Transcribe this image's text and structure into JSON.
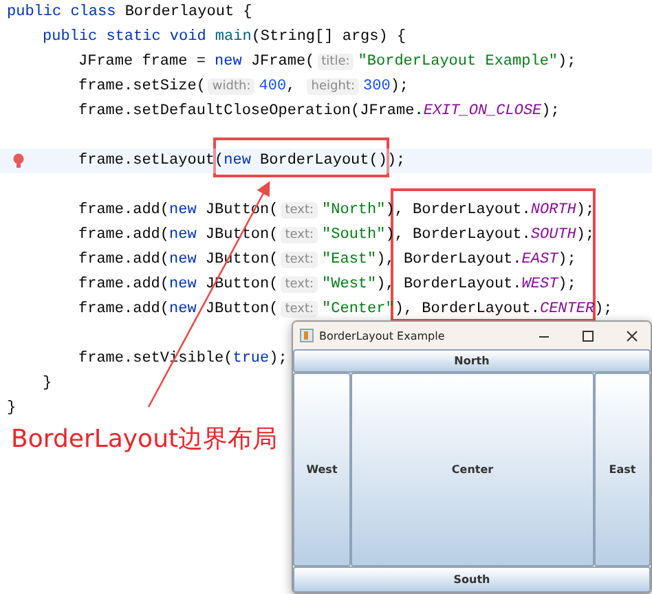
{
  "code_lines": [
    {
      "kind": "code",
      "current": false,
      "bulb": false,
      "tokens": [
        {
          "kind": "kw",
          "t": "public class "
        },
        {
          "kind": "plain",
          "t": "Borderlayout {"
        }
      ],
      "children": [
        {
          "kind": "code",
          "current": false,
          "bulb": false,
          "tokens": [
            {
              "kind": "kw",
              "t": "public static void "
            },
            {
              "kind": "method",
              "t": "main"
            },
            {
              "kind": "plain",
              "t": "(String[] args) {"
            }
          ],
          "children": [
            {
              "kind": "code",
              "current": false,
              "bulb": false,
              "tokens": [
                {
                  "kind": "plain",
                  "t": "JFrame frame = "
                },
                {
                  "kind": "kw",
                  "t": "new "
                },
                {
                  "kind": "plain",
                  "t": "JFrame("
                },
                {
                  "kind": "hint",
                  "t": "title:"
                },
                {
                  "kind": "str",
                  "t": "\"BorderLayout Example\""
                },
                {
                  "kind": "plain",
                  "t": ");"
                }
              ]
            },
            {
              "kind": "code",
              "current": false,
              "bulb": false,
              "tokens": [
                {
                  "kind": "plain",
                  "t": "frame.setSize("
                },
                {
                  "kind": "hint",
                  "t": "width:"
                },
                {
                  "kind": "num",
                  "t": "400"
                },
                {
                  "kind": "plain",
                  "t": ", "
                },
                {
                  "kind": "hint",
                  "t": "height:"
                },
                {
                  "kind": "num",
                  "t": "300"
                },
                {
                  "kind": "plain",
                  "t": ");"
                }
              ]
            },
            {
              "kind": "code",
              "current": false,
              "bulb": false,
              "tokens": [
                {
                  "kind": "plain",
                  "t": "frame.setDefaultCloseOperation(JFrame."
                },
                {
                  "kind": "const",
                  "t": "EXIT_ON_CLOSE"
                },
                {
                  "kind": "plain",
                  "t": ");"
                }
              ]
            },
            {
              "kind": "blank",
              "current": false,
              "bulb": false
            },
            {
              "kind": "code",
              "current": true,
              "bulb": true,
              "tokens": [
                {
                  "kind": "plain",
                  "t": "frame.setLayout("
                },
                {
                  "kind": "kw",
                  "t": "new "
                },
                {
                  "kind": "plain",
                  "t": "BorderLayout());"
                }
              ]
            },
            {
              "kind": "blank",
              "current": false,
              "bulb": false
            },
            {
              "kind": "code",
              "current": false,
              "bulb": false,
              "tokens": [
                {
                  "kind": "plain",
                  "t": "frame.add("
                },
                {
                  "kind": "kw",
                  "t": "new "
                },
                {
                  "kind": "plain",
                  "t": "JButton("
                },
                {
                  "kind": "hint",
                  "t": "text:"
                },
                {
                  "kind": "str",
                  "t": "\"North\""
                },
                {
                  "kind": "plain",
                  "t": "), BorderLayout."
                },
                {
                  "kind": "const",
                  "t": "NORTH"
                },
                {
                  "kind": "plain",
                  "t": ");"
                }
              ]
            },
            {
              "kind": "code",
              "current": false,
              "bulb": false,
              "tokens": [
                {
                  "kind": "plain",
                  "t": "frame.add("
                },
                {
                  "kind": "kw",
                  "t": "new "
                },
                {
                  "kind": "plain",
                  "t": "JButton("
                },
                {
                  "kind": "hint",
                  "t": "text:"
                },
                {
                  "kind": "str",
                  "t": "\"South\""
                },
                {
                  "kind": "plain",
                  "t": "), BorderLayout."
                },
                {
                  "kind": "const",
                  "t": "SOUTH"
                },
                {
                  "kind": "plain",
                  "t": ");"
                }
              ]
            },
            {
              "kind": "code",
              "current": false,
              "bulb": false,
              "tokens": [
                {
                  "kind": "plain",
                  "t": "frame.add("
                },
                {
                  "kind": "kw",
                  "t": "new "
                },
                {
                  "kind": "plain",
                  "t": "JButton("
                },
                {
                  "kind": "hint",
                  "t": "text:"
                },
                {
                  "kind": "str",
                  "t": "\"East\""
                },
                {
                  "kind": "plain",
                  "t": "), BorderLayout."
                },
                {
                  "kind": "const",
                  "t": "EAST"
                },
                {
                  "kind": "plain",
                  "t": ");"
                }
              ]
            },
            {
              "kind": "code",
              "current": false,
              "bulb": false,
              "tokens": [
                {
                  "kind": "plain",
                  "t": "frame.add("
                },
                {
                  "kind": "kw",
                  "t": "new "
                },
                {
                  "kind": "plain",
                  "t": "JButton("
                },
                {
                  "kind": "hint",
                  "t": "text:"
                },
                {
                  "kind": "str",
                  "t": "\"West\""
                },
                {
                  "kind": "plain",
                  "t": "), BorderLayout."
                },
                {
                  "kind": "const",
                  "t": "WEST"
                },
                {
                  "kind": "plain",
                  "t": ");"
                }
              ]
            },
            {
              "kind": "code",
              "current": false,
              "bulb": false,
              "tokens": [
                {
                  "kind": "plain",
                  "t": "frame.add("
                },
                {
                  "kind": "kw",
                  "t": "new "
                },
                {
                  "kind": "plain",
                  "t": "JButton("
                },
                {
                  "kind": "hint",
                  "t": "text:"
                },
                {
                  "kind": "str",
                  "t": "\"Center\""
                },
                {
                  "kind": "plain",
                  "t": "), BorderLayout."
                },
                {
                  "kind": "const",
                  "t": "CENTER"
                },
                {
                  "kind": "plain",
                  "t": ");"
                }
              ]
            },
            {
              "kind": "blank",
              "current": false,
              "bulb": false
            },
            {
              "kind": "code",
              "current": false,
              "bulb": false,
              "tokens": [
                {
                  "kind": "plain",
                  "t": "frame.setVisible("
                },
                {
                  "kind": "kw",
                  "t": "true"
                },
                {
                  "kind": "plain",
                  "t": ");"
                }
              ]
            }
          ]
        },
        {
          "kind": "code",
          "current": false,
          "bulb": false,
          "tokens": [
            {
              "kind": "plain",
              "t": "}"
            }
          ]
        }
      ]
    },
    {
      "kind": "code",
      "current": false,
      "bulb": false,
      "tokens": [
        {
          "kind": "plain",
          "t": "}"
        }
      ]
    }
  ],
  "annotation": {
    "text": "BorderLayout边界布局"
  },
  "window": {
    "title": "BorderLayout Example",
    "buttons": [
      {
        "kind": "north",
        "label": "North"
      },
      {
        "kind": "west",
        "label": "West"
      },
      {
        "kind": "center",
        "label": "Center"
      },
      {
        "kind": "east",
        "label": "East"
      },
      {
        "kind": "south",
        "label": "South"
      }
    ]
  }
}
